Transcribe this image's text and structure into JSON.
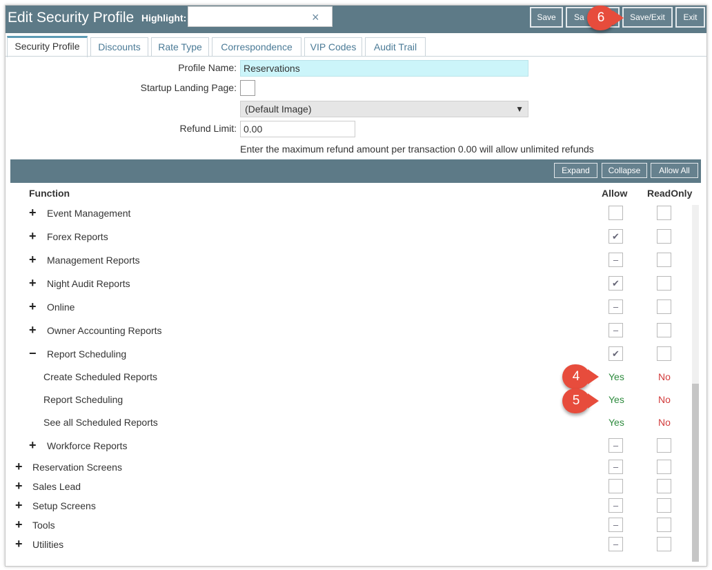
{
  "header": {
    "title": "Edit Security Profile",
    "highlight_label": "Highlight:",
    "highlight_value": "",
    "clear_icon": "×",
    "buttons": {
      "save": "Save",
      "save_new": "Sa",
      "save_exit": "Save/Exit",
      "exit": "Exit"
    }
  },
  "tabs": [
    "Security Profile",
    "Discounts",
    "Rate Type",
    "Correspondence",
    "VIP Codes",
    "Audit Trail"
  ],
  "form": {
    "profile_name_label": "Profile Name:",
    "profile_name": "Reservations",
    "startup_label": "Startup Landing Page:",
    "image_select": "(Default Image)",
    "refund_label": "Refund Limit:",
    "refund_value": "0.00",
    "refund_hint": "Enter the maximum refund amount per transaction 0.00 will allow unlimited refunds"
  },
  "grid": {
    "buttons": {
      "expand": "Expand",
      "collapse": "Collapse",
      "allow_all": "Allow All"
    },
    "headers": {
      "function": "Function",
      "allow": "Allow",
      "readonly": "ReadOnly"
    },
    "rows": [
      {
        "label": "Event Management",
        "expander": "+",
        "allow": "",
        "readonly": ""
      },
      {
        "label": "Forex Reports",
        "expander": "+",
        "allow": "✔",
        "readonly": ""
      },
      {
        "label": "Management Reports",
        "expander": "+",
        "allow": "–",
        "readonly": ""
      },
      {
        "label": "Night Audit Reports",
        "expander": "+",
        "allow": "✔",
        "readonly": ""
      },
      {
        "label": "Online",
        "expander": "+",
        "allow": "–",
        "readonly": ""
      },
      {
        "label": "Owner Accounting Reports",
        "expander": "+",
        "allow": "–",
        "readonly": ""
      },
      {
        "label": "Report Scheduling",
        "expander": "−",
        "allow": "✔",
        "readonly": ""
      },
      {
        "label": "Create Scheduled Reports",
        "allow": "Yes",
        "readonly": "No"
      },
      {
        "label": "Report Scheduling",
        "allow": "Yes",
        "readonly": "No"
      },
      {
        "label": "See all Scheduled Reports",
        "allow": "Yes",
        "readonly": "No"
      },
      {
        "label": "Workforce Reports",
        "expander": "+",
        "allow": "–",
        "readonly": ""
      },
      {
        "label": "Reservation Screens",
        "expander": "+",
        "allow": "–",
        "readonly": ""
      },
      {
        "label": "Sales Lead",
        "expander": "+",
        "allow": "",
        "readonly": ""
      },
      {
        "label": "Setup Screens",
        "expander": "+",
        "allow": "–",
        "readonly": ""
      },
      {
        "label": "Tools",
        "expander": "+",
        "allow": "–",
        "readonly": ""
      },
      {
        "label": "Utilities",
        "expander": "+",
        "allow": "–",
        "readonly": ""
      }
    ]
  },
  "callouts": {
    "c4": "4",
    "c5": "5",
    "c6": "6"
  },
  "colors": {
    "header_bg": "#5d7a87",
    "yes": "#2e8b3e",
    "no": "#d23a3a",
    "callout": "#e74c3c",
    "name_field_bg": "#ccf5fa"
  }
}
